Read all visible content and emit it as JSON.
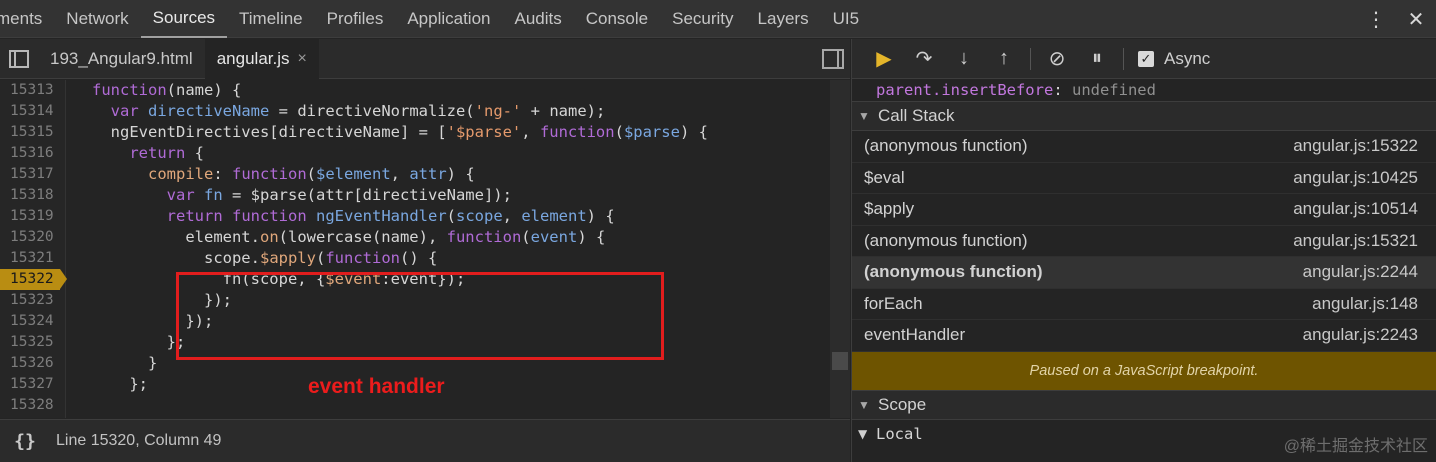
{
  "top_tabs": [
    "ments",
    "Network",
    "Sources",
    "Timeline",
    "Profiles",
    "Application",
    "Audits",
    "Console",
    "Security",
    "Layers",
    "UI5"
  ],
  "active_tab": "Sources",
  "file_tabs": [
    {
      "label": "193_Angular9.html",
      "active": false
    },
    {
      "label": "angular.js",
      "active": true,
      "close": "×"
    }
  ],
  "code_lines": [
    {
      "num": "15313",
      "html": "<span class=\"kw\">function</span>(name) {"
    },
    {
      "num": "15314",
      "html": "  <span class=\"kw\">var</span> <span class=\"vr\">directiveName</span> = directiveNormalize(<span class=\"st\">'ng-'</span> + name);"
    },
    {
      "num": "15315",
      "html": "  ngEventDirectives[directiveName] = [<span class=\"st\">'$parse'</span>, <span class=\"kw\">function</span>(<span class=\"vr\">$parse</span>) {"
    },
    {
      "num": "15316",
      "html": "    <span class=\"kw\">return</span> {"
    },
    {
      "num": "15317",
      "html": "      <span class=\"pr\">compile</span>: <span class=\"kw\">function</span>(<span class=\"vr\">$element</span>, <span class=\"vr\">attr</span>) {"
    },
    {
      "num": "15318",
      "html": "        <span class=\"kw\">var</span> <span class=\"vr\">fn</span> = $parse(attr[directiveName]);"
    },
    {
      "num": "15319",
      "html": "        <span class=\"kw\">return</span> <span class=\"kw\">function</span> <span class=\"vr\">ngEventHandler</span>(<span class=\"vr\">scope</span>, <span class=\"vr\">element</span>) {"
    },
    {
      "num": "15320",
      "html": "          element.<span class=\"pr\">on</span>(lowercase(name), <span class=\"kw\">function</span>(<span class=\"vr\">event</span>) {"
    },
    {
      "num": "15321",
      "html": "            scope.<span class=\"pr\">$apply</span>(<span class=\"kw\">function</span>() {"
    },
    {
      "num": "15322",
      "html": "              fn(scope, {<span class=\"pr\">$event</span>:event});"
    },
    {
      "num": "15323",
      "html": "            });"
    },
    {
      "num": "15324",
      "html": "          });"
    },
    {
      "num": "15325",
      "html": "        };"
    },
    {
      "num": "15326",
      "html": "      }"
    },
    {
      "num": "15327",
      "html": "    };"
    },
    {
      "num": "15328",
      "html": ""
    }
  ],
  "breakpoint_line": "15322",
  "status": {
    "braces": "{}",
    "position": "Line 15320, Column 49"
  },
  "annotation": "event handler",
  "debugger": {
    "async_label": "Async",
    "async_checked": true
  },
  "watch": {
    "key": "parent.insertBefore",
    "value": "undefined"
  },
  "call_stack": {
    "title": "Call Stack",
    "frames": [
      {
        "name": "(anonymous function)",
        "loc": "angular.js:15322",
        "selected": false
      },
      {
        "name": "$eval",
        "loc": "angular.js:10425",
        "selected": false
      },
      {
        "name": "$apply",
        "loc": "angular.js:10514",
        "selected": false
      },
      {
        "name": "(anonymous function)",
        "loc": "angular.js:15321",
        "selected": false
      },
      {
        "name": "(anonymous function)",
        "loc": "angular.js:2244",
        "selected": true
      },
      {
        "name": "forEach",
        "loc": "angular.js:148",
        "selected": false
      },
      {
        "name": "eventHandler",
        "loc": "angular.js:2243",
        "selected": false
      }
    ]
  },
  "paused_message": "Paused on a JavaScript breakpoint.",
  "scope": {
    "title": "Scope",
    "local": "Local"
  },
  "watermark": "@稀土掘金技术社区"
}
